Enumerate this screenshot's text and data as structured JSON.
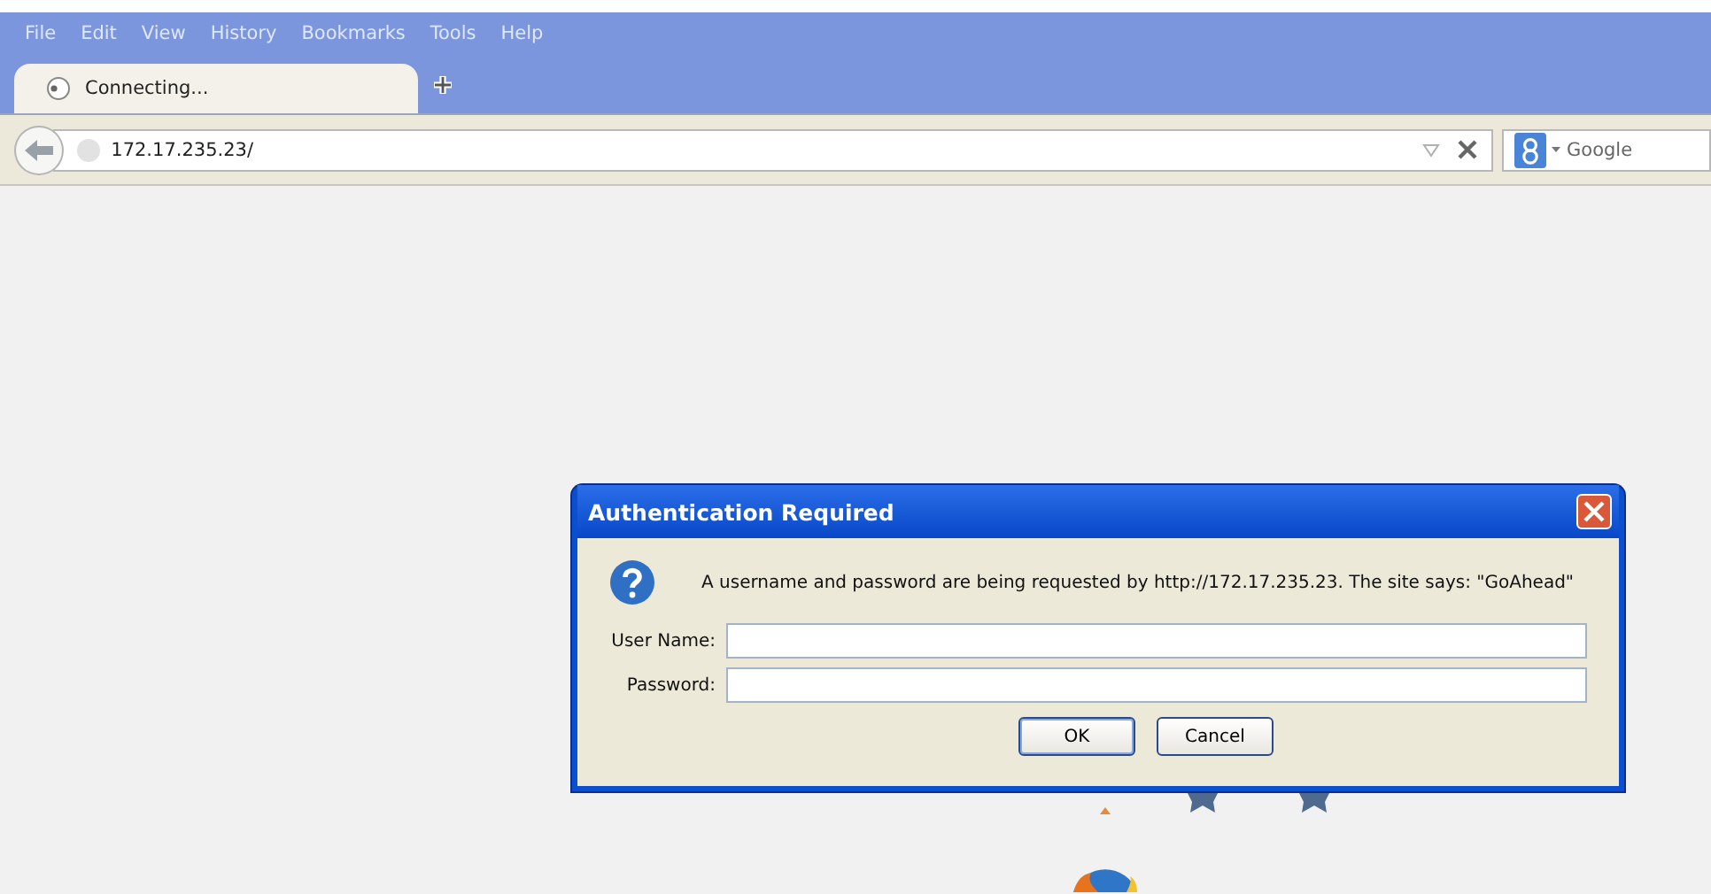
{
  "menu": [
    "File",
    "Edit",
    "View",
    "History",
    "Bookmarks",
    "Tools",
    "Help"
  ],
  "tabs": [
    {
      "label": "Connecting...",
      "selected": true
    }
  ],
  "address": {
    "value": "172.17.235.23/"
  },
  "search": {
    "placeholder": "Google"
  },
  "dialog": {
    "title": "Authentication Required",
    "message": "A username and password are being requested by http://172.17.235.23. The site says: \"GoAhead\"",
    "fields": [
      {
        "label": "User Name:"
      },
      {
        "label": "Password:"
      }
    ],
    "buttons": [
      {
        "label": "OK",
        "default": true
      },
      {
        "label": "Cancel",
        "default": false
      }
    ]
  }
}
